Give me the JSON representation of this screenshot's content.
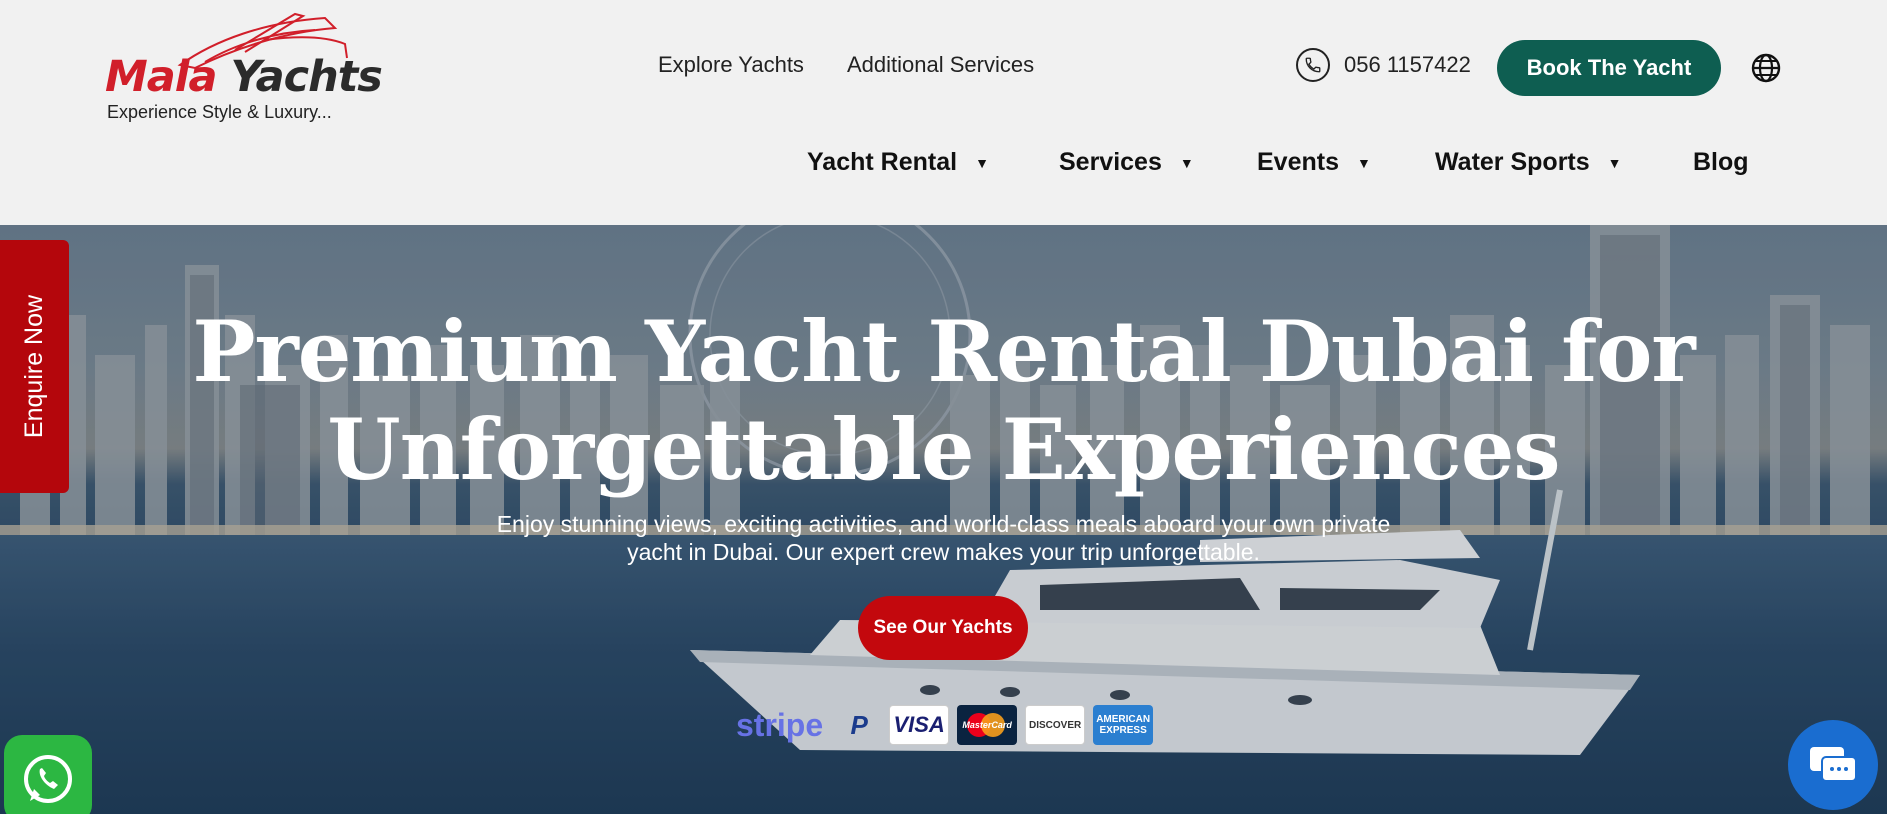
{
  "brand": {
    "name_part1": "Mala",
    "name_part2": "Yachts",
    "tagline": "Experience Style & Luxury..."
  },
  "topnav": {
    "explore": "Explore Yachts",
    "additional": "Additional Services",
    "phone": "056 1157422",
    "book_label": "Book The Yacht",
    "globe_icon": "globe-icon"
  },
  "mainnav": {
    "items": [
      {
        "label": "Yacht Rental",
        "dropdown": true
      },
      {
        "label": "Services",
        "dropdown": true
      },
      {
        "label": "Events",
        "dropdown": true
      },
      {
        "label": "Water Sports",
        "dropdown": true
      },
      {
        "label": "Blog",
        "dropdown": false
      }
    ]
  },
  "hero": {
    "title_line1": "Premium Yacht Rental Dubai for",
    "title_line2": "Unforgettable Experiences",
    "subtitle_line1": "Enjoy stunning views, exciting activities, and world-class meals aboard your own private",
    "subtitle_line2": "yacht in Dubai. Our expert crew makes your trip unforgettable.",
    "cta_label": "See Our Yachts"
  },
  "payments": {
    "stripe": "stripe",
    "paypal": "P",
    "visa": "VISA",
    "mastercard": "MasterCard",
    "discover": "DISCOVER",
    "amex_line1": "AMERICAN",
    "amex_line2": "EXPRESS"
  },
  "floating": {
    "enquire": "Enquire Now",
    "whatsapp_icon": "whatsapp-icon",
    "chat_icon": "chat-icon"
  },
  "colors": {
    "brand_red": "#d11f2a",
    "book_green": "#0e5e51",
    "cta_red": "#c3080d",
    "enquire_red": "#b4060c",
    "whatsapp_green": "#2cb742",
    "chat_blue": "#1a6dd0"
  }
}
